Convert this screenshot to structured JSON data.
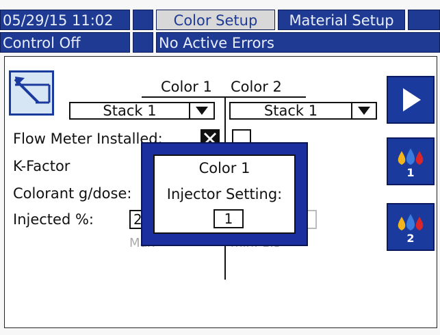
{
  "header": {
    "datetime": "05/29/15 11:02",
    "tabs": [
      {
        "label": "Color Setup",
        "active": true
      },
      {
        "label": "Material Setup",
        "active": false
      }
    ],
    "control_status": "Control Off",
    "error_status": "No Active Errors"
  },
  "columns": {
    "color1_label": "Color 1",
    "color2_label": "Color 2"
  },
  "stack_selects": {
    "color1_value": "Stack 1",
    "color2_value": "Stack 1"
  },
  "rows": {
    "flow_meter_label": "Flow Meter Installed:",
    "flow_meter_color1_checked": true,
    "flow_meter_color2_checked": false,
    "k_factor_label": "K-Factor",
    "colorant_label": "Colorant g/dose:",
    "injected_label": "Injected %:",
    "injected_color1_value": "2",
    "max_color1": "Max",
    "min_color2": "min: 1.5"
  },
  "popup": {
    "title": "Color 1",
    "label": "Injector Setting:",
    "value": "1"
  },
  "buttons": {
    "injector1_number": "1",
    "injector2_number": "2"
  },
  "colors": {
    "header_blue": "#1f3a93",
    "button_blue": "#1b3a9e",
    "drop_blue": "#3a7be0",
    "drop_red": "#d8262b",
    "drop_yellow": "#f2b51c"
  }
}
